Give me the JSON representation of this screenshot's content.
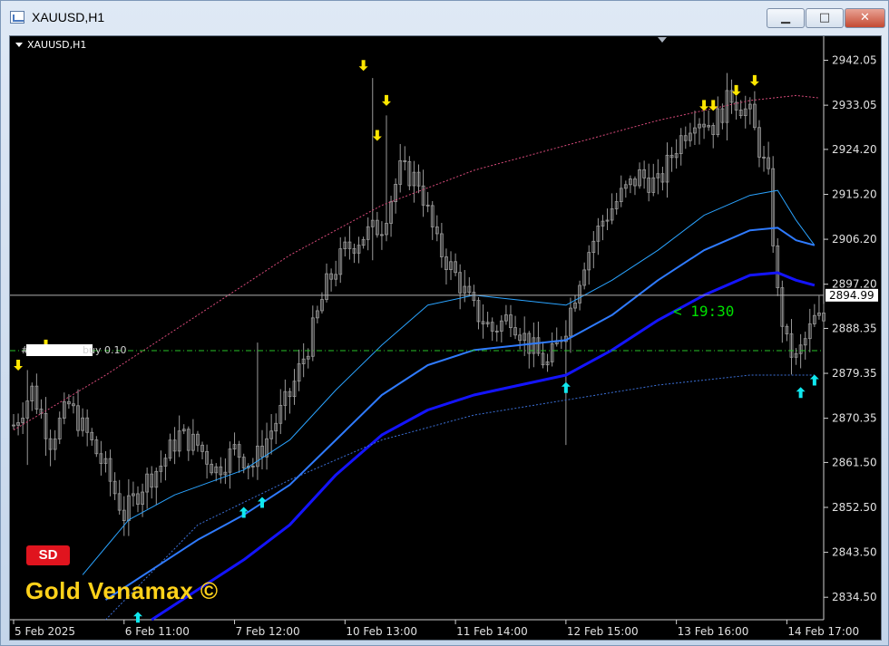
{
  "window": {
    "title": "XAUUSD,H1",
    "min_glyph": "▁",
    "max_glyph": "□",
    "close_glyph": "✕"
  },
  "chart_header": {
    "symbol": "XAUUSD,H1"
  },
  "timer": "< 19:30",
  "order_line": {
    "hash": "#",
    "text": "buy 0.10",
    "price": 2883.9
  },
  "badge": "SD",
  "brand": "Gold Venamax ©",
  "colors": {
    "background": "#000000",
    "candles": "#9a9a9a",
    "band_light": "#2aa3ff",
    "band_mid": "#2f7bff",
    "band_main": "#1414ff",
    "band_dotted": "#3b6fd6",
    "envelope_dotted": "#d64a7a",
    "arrow_down": "#ffe600",
    "arrow_up": "#10e8ef",
    "order_line": "#27c227",
    "current_price_line": "#b0b0b0"
  },
  "chart_data": {
    "type": "candlestick",
    "title": "XAUUSD,H1",
    "xlabel": "",
    "ylabel": "",
    "x_range": [
      0,
      176
    ],
    "ylim": [
      2830.0,
      2946.5
    ],
    "y_ticks": [
      "2942.05",
      "2933.05",
      "2924.20",
      "2915.20",
      "2906.20",
      "2897.20",
      "2888.35",
      "2879.35",
      "2870.35",
      "2861.50",
      "2852.50",
      "2843.50",
      "2834.50"
    ],
    "y_tick_values": [
      2942.05,
      2933.05,
      2924.2,
      2915.2,
      2906.2,
      2897.2,
      2888.35,
      2879.35,
      2870.35,
      2861.5,
      2852.5,
      2843.5,
      2834.5
    ],
    "x_ticks": [
      {
        "label": "5 Feb 2025",
        "x": 0
      },
      {
        "label": "6 Feb 11:00",
        "x": 24
      },
      {
        "label": "7 Feb 12:00",
        "x": 48
      },
      {
        "label": "10 Feb 13:00",
        "x": 72
      },
      {
        "label": "11 Feb 14:00",
        "x": 96
      },
      {
        "label": "12 Feb 15:00",
        "x": 120
      },
      {
        "label": "13 Feb 16:00",
        "x": 144
      },
      {
        "label": "14 Feb 17:00",
        "x": 168
      }
    ],
    "current_price": 2894.99,
    "current_price_label": "2894.99",
    "close_anchors": [
      [
        0,
        2869
      ],
      [
        4,
        2876
      ],
      [
        8,
        2866
      ],
      [
        12,
        2873
      ],
      [
        16,
        2867
      ],
      [
        20,
        2860
      ],
      [
        24,
        2851
      ],
      [
        28,
        2857
      ],
      [
        32,
        2861
      ],
      [
        36,
        2867
      ],
      [
        40,
        2865
      ],
      [
        44,
        2860
      ],
      [
        48,
        2864
      ],
      [
        52,
        2861
      ],
      [
        56,
        2868
      ],
      [
        60,
        2875
      ],
      [
        64,
        2885
      ],
      [
        68,
        2897
      ],
      [
        72,
        2904
      ],
      [
        76,
        2907
      ],
      [
        80,
        2909
      ],
      [
        84,
        2920
      ],
      [
        88,
        2918
      ],
      [
        92,
        2905
      ],
      [
        96,
        2899
      ],
      [
        100,
        2892
      ],
      [
        104,
        2888
      ],
      [
        108,
        2891
      ],
      [
        112,
        2885
      ],
      [
        116,
        2881
      ],
      [
        120,
        2889
      ],
      [
        124,
        2902
      ],
      [
        128,
        2910
      ],
      [
        132,
        2915
      ],
      [
        136,
        2919
      ],
      [
        140,
        2917
      ],
      [
        144,
        2925
      ],
      [
        148,
        2931
      ],
      [
        152,
        2929
      ],
      [
        156,
        2935
      ],
      [
        160,
        2931
      ],
      [
        164,
        2918
      ],
      [
        166,
        2895
      ],
      [
        168,
        2885
      ],
      [
        170,
        2882
      ],
      [
        172,
        2886
      ],
      [
        174,
        2890
      ]
    ],
    "spikes": [
      {
        "x": 78,
        "high": 2938.5,
        "low": 2902
      },
      {
        "x": 81,
        "high": 2931,
        "low": 2908
      },
      {
        "x": 53,
        "high": 2885.5,
        "low": 2858
      },
      {
        "x": 120,
        "high": 2890,
        "low": 2865
      },
      {
        "x": 3,
        "high": 2880,
        "low": 2861
      },
      {
        "x": 155,
        "high": 2939.5,
        "low": 2926
      }
    ],
    "series": [
      {
        "name": "",
        "style": "dotted",
        "color": "#d64a7a",
        "points": [
          [
            0,
            2868
          ],
          [
            20,
            2879
          ],
          [
            40,
            2891
          ],
          [
            60,
            2903
          ],
          [
            80,
            2913
          ],
          [
            100,
            2920
          ],
          [
            120,
            2925
          ],
          [
            140,
            2930
          ],
          [
            160,
            2934
          ],
          [
            170,
            2935
          ],
          [
            175,
            2934.5
          ]
        ]
      },
      {
        "name": "",
        "style": "solid-thin",
        "color": "#2aa3ff",
        "points": [
          [
            15,
            2839
          ],
          [
            25,
            2850
          ],
          [
            35,
            2855
          ],
          [
            50,
            2860
          ],
          [
            60,
            2866
          ],
          [
            70,
            2876
          ],
          [
            80,
            2885
          ],
          [
            90,
            2893
          ],
          [
            100,
            2895
          ],
          [
            110,
            2894
          ],
          [
            120,
            2893
          ],
          [
            130,
            2898
          ],
          [
            140,
            2904
          ],
          [
            150,
            2911
          ],
          [
            160,
            2915
          ],
          [
            166,
            2916
          ],
          [
            170,
            2910
          ],
          [
            174,
            2905
          ]
        ]
      },
      {
        "name": "",
        "style": "solid",
        "color": "#2f7bff",
        "points": [
          [
            20,
            2834
          ],
          [
            30,
            2840
          ],
          [
            40,
            2846
          ],
          [
            50,
            2851
          ],
          [
            60,
            2857
          ],
          [
            70,
            2866
          ],
          [
            80,
            2875
          ],
          [
            90,
            2881
          ],
          [
            100,
            2884
          ],
          [
            110,
            2885
          ],
          [
            120,
            2886
          ],
          [
            130,
            2891
          ],
          [
            140,
            2898
          ],
          [
            150,
            2904
          ],
          [
            160,
            2908
          ],
          [
            166,
            2908.5
          ],
          [
            170,
            2906
          ],
          [
            174,
            2905
          ]
        ]
      },
      {
        "name": "",
        "style": "solid-thick",
        "color": "#1414ff",
        "points": [
          [
            30,
            2830
          ],
          [
            40,
            2836
          ],
          [
            50,
            2842
          ],
          [
            60,
            2849
          ],
          [
            70,
            2859
          ],
          [
            80,
            2867
          ],
          [
            90,
            2872
          ],
          [
            100,
            2875
          ],
          [
            110,
            2877
          ],
          [
            120,
            2879
          ],
          [
            130,
            2884
          ],
          [
            140,
            2890
          ],
          [
            150,
            2895
          ],
          [
            160,
            2899
          ],
          [
            166,
            2899.5
          ],
          [
            170,
            2898
          ],
          [
            174,
            2897
          ]
        ]
      },
      {
        "name": "",
        "style": "dotted",
        "color": "#3b6fd6",
        "points": [
          [
            20,
            2830
          ],
          [
            40,
            2849
          ],
          [
            60,
            2858
          ],
          [
            80,
            2866
          ],
          [
            100,
            2871
          ],
          [
            120,
            2874
          ],
          [
            140,
            2877
          ],
          [
            160,
            2879
          ],
          [
            170,
            2879
          ],
          [
            174,
            2879
          ]
        ]
      }
    ],
    "arrows_down": [
      {
        "x": 1,
        "y": 2881
      },
      {
        "x": 7,
        "y": 2885
      },
      {
        "x": 76,
        "y": 2941
      },
      {
        "x": 79,
        "y": 2927
      },
      {
        "x": 81,
        "y": 2934
      },
      {
        "x": 150,
        "y": 2933
      },
      {
        "x": 152,
        "y": 2933
      },
      {
        "x": 157,
        "y": 2936
      },
      {
        "x": 161,
        "y": 2938
      }
    ],
    "arrows_up": [
      {
        "x": 27,
        "y": 2830.5
      },
      {
        "x": 50,
        "y": 2851.5
      },
      {
        "x": 54,
        "y": 2853.5
      },
      {
        "x": 120,
        "y": 2876.5
      },
      {
        "x": 171,
        "y": 2875.5
      },
      {
        "x": 174,
        "y": 2878
      }
    ]
  }
}
